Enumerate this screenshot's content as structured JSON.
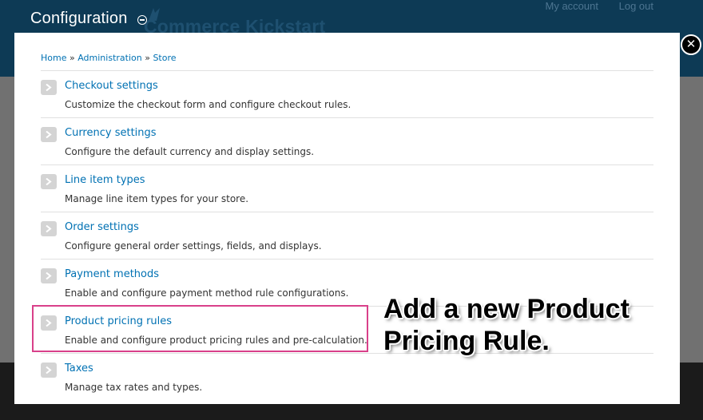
{
  "background": {
    "site_name": "Commerce Kickstart",
    "user_links": [
      "My account",
      "Log out"
    ]
  },
  "overlay": {
    "title": "Configuration"
  },
  "breadcrumb": {
    "items": [
      "Home",
      "Administration",
      "Store"
    ],
    "separator": "»"
  },
  "items": [
    {
      "title": "Checkout settings",
      "description": "Customize the checkout form and configure checkout rules."
    },
    {
      "title": "Currency settings",
      "description": "Configure the default currency and display settings."
    },
    {
      "title": "Line item types",
      "description": "Manage line item types for your store."
    },
    {
      "title": "Order settings",
      "description": "Configure general order settings, fields, and displays."
    },
    {
      "title": "Payment methods",
      "description": "Enable and configure payment method rule configurations."
    },
    {
      "title": "Product pricing rules",
      "description": "Enable and configure product pricing rules and pre-calculation."
    },
    {
      "title": "Taxes",
      "description": "Manage tax rates and types."
    }
  ],
  "annotation": {
    "text": "Add a new Product Pricing Rule."
  },
  "colors": {
    "link": "#0071b3",
    "highlight": "#d9408a",
    "header_bg": "#0d3a55"
  }
}
